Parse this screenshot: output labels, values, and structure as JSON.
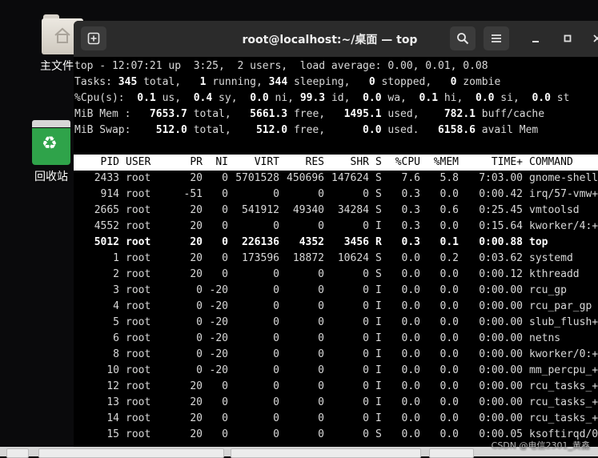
{
  "desktop": {
    "home_label": "主文件夹",
    "trash_label": "回收站"
  },
  "window": {
    "title": "root@localhost:~/桌面 — top"
  },
  "summary": {
    "line1": "top - 12:07:21 up  3:25,  2 users,  load average: 0.00, 0.01, 0.08",
    "tasks": {
      "total": "345",
      "running": "1",
      "sleeping": "344",
      "stopped": "0",
      "zombie": "0"
    },
    "cpu": {
      "us": "0.1",
      "sy": "0.4",
      "ni": "0.0",
      "id": "99.3",
      "wa": "0.0",
      "hi": "0.1",
      "si": "0.0",
      "st": "0.0"
    },
    "mem": {
      "total": "7653.7",
      "free": "5661.3",
      "used": "1495.1",
      "buff_cache": "782.1"
    },
    "swap": {
      "total": "512.0",
      "free": "512.0",
      "used": "0.0",
      "avail_mem": "6158.6"
    }
  },
  "table": {
    "columns": [
      "PID",
      "USER",
      "PR",
      "NI",
      "VIRT",
      "RES",
      "SHR",
      "S",
      "%CPU",
      "%MEM",
      "TIME+",
      "COMMAND"
    ],
    "rows": [
      [
        "2433",
        "root",
        "20",
        "0",
        "5701528",
        "450696",
        "147624",
        "S",
        "7.6",
        "5.8",
        "7:03.00",
        "gnome-shell"
      ],
      [
        "914",
        "root",
        "-51",
        "0",
        "0",
        "0",
        "0",
        "S",
        "0.3",
        "0.0",
        "0:00.42",
        "irq/57-vmw+"
      ],
      [
        "2665",
        "root",
        "20",
        "0",
        "541912",
        "49340",
        "34284",
        "S",
        "0.3",
        "0.6",
        "0:25.45",
        "vmtoolsd"
      ],
      [
        "4552",
        "root",
        "20",
        "0",
        "0",
        "0",
        "0",
        "I",
        "0.3",
        "0.0",
        "0:15.64",
        "kworker/4:+"
      ],
      [
        "5012",
        "root",
        "20",
        "0",
        "226136",
        "4352",
        "3456",
        "R",
        "0.3",
        "0.1",
        "0:00.88",
        "top"
      ],
      [
        "1",
        "root",
        "20",
        "0",
        "173596",
        "18872",
        "10624",
        "S",
        "0.0",
        "0.2",
        "0:03.62",
        "systemd"
      ],
      [
        "2",
        "root",
        "20",
        "0",
        "0",
        "0",
        "0",
        "S",
        "0.0",
        "0.0",
        "0:00.12",
        "kthreadd"
      ],
      [
        "3",
        "root",
        "0",
        "-20",
        "0",
        "0",
        "0",
        "I",
        "0.0",
        "0.0",
        "0:00.00",
        "rcu_gp"
      ],
      [
        "4",
        "root",
        "0",
        "-20",
        "0",
        "0",
        "0",
        "I",
        "0.0",
        "0.0",
        "0:00.00",
        "rcu_par_gp"
      ],
      [
        "5",
        "root",
        "0",
        "-20",
        "0",
        "0",
        "0",
        "I",
        "0.0",
        "0.0",
        "0:00.00",
        "slub_flush+"
      ],
      [
        "6",
        "root",
        "0",
        "-20",
        "0",
        "0",
        "0",
        "I",
        "0.0",
        "0.0",
        "0:00.00",
        "netns"
      ],
      [
        "8",
        "root",
        "0",
        "-20",
        "0",
        "0",
        "0",
        "I",
        "0.0",
        "0.0",
        "0:00.00",
        "kworker/0:+"
      ],
      [
        "10",
        "root",
        "0",
        "-20",
        "0",
        "0",
        "0",
        "I",
        "0.0",
        "0.0",
        "0:00.00",
        "mm_percpu_+"
      ],
      [
        "12",
        "root",
        "20",
        "0",
        "0",
        "0",
        "0",
        "I",
        "0.0",
        "0.0",
        "0:00.00",
        "rcu_tasks_+"
      ],
      [
        "13",
        "root",
        "20",
        "0",
        "0",
        "0",
        "0",
        "I",
        "0.0",
        "0.0",
        "0:00.00",
        "rcu_tasks_+"
      ],
      [
        "14",
        "root",
        "20",
        "0",
        "0",
        "0",
        "0",
        "I",
        "0.0",
        "0.0",
        "0:00.00",
        "rcu_tasks_+"
      ],
      [
        "15",
        "root",
        "20",
        "0",
        "0",
        "0",
        "0",
        "S",
        "0.0",
        "0.0",
        "0:00.05",
        "ksoftirqd/0"
      ]
    ],
    "highlighted_pid": "5012"
  },
  "watermark": "CSDN @电信2301_黄鑫"
}
